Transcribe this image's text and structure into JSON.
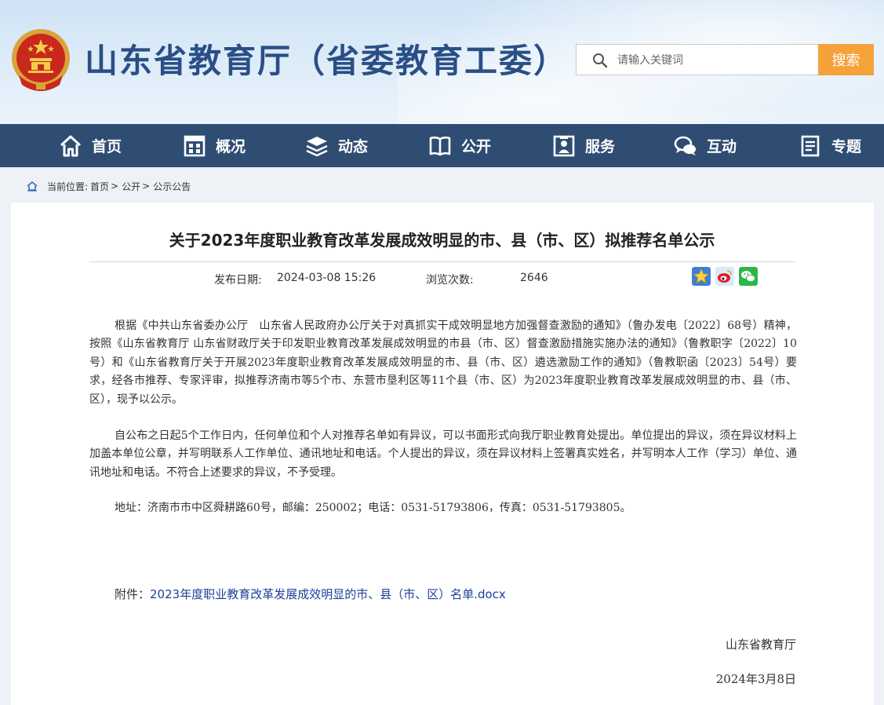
{
  "header": {
    "site_title": "山东省教育厅（省委教育工委）",
    "search": {
      "placeholder": "请输入关键词",
      "button_label": "搜索"
    }
  },
  "nav": {
    "items": [
      {
        "label": "首页",
        "icon": "home-icon"
      },
      {
        "label": "概况",
        "icon": "building-icon"
      },
      {
        "label": "动态",
        "icon": "layers-icon"
      },
      {
        "label": "公开",
        "icon": "open-book-icon"
      },
      {
        "label": "服务",
        "icon": "service-icon"
      },
      {
        "label": "互动",
        "icon": "chat-icon"
      },
      {
        "label": "专题",
        "icon": "document-icon"
      }
    ]
  },
  "breadcrumb": {
    "prefix": "当前位置:",
    "items": [
      "首页",
      "公开",
      "公示公告"
    ],
    "separator": ">"
  },
  "article": {
    "title": "关于2023年度职业教育改革发展成效明显的市、县（市、区）拟推荐名单公示",
    "publish_label": "发布日期:",
    "publish_date": "2024-03-08 15:26",
    "views_label": "浏览次数:",
    "views": "2646",
    "share_icons": [
      "star-favorite-icon",
      "weibo-icon",
      "wechat-icon"
    ],
    "paragraphs": [
      "根据《中共山东省委办公厅　山东省人民政府办公厅关于对真抓实干成效明显地方加强督查激励的通知》（鲁办发电〔2022〕68号）精神，按照《山东省教育厅 山东省财政厅关于印发职业教育改革发展成效明显的市县（市、区）督查激励措施实施办法的通知》（鲁教职字〔2022〕10号）和《山东省教育厅关于开展2023年度职业教育改革发展成效明显的市、县（市、区）遴选激励工作的通知》（鲁教职函〔2023〕54号）要求，经各市推荐、专家评审，拟推荐济南市等5个市、东营市垦利区等11个县（市、区）为2023年度职业教育改革发展成效明显的市、县（市、区），现予以公示。",
      "自公布之日起5个工作日内，任何单位和个人对推荐名单如有异议，可以书面形式向我厅职业教育处提出。单位提出的异议，须在异议材料上加盖本单位公章，并写明联系人工作单位、通讯地址和电话。个人提出的异议，须在异议材料上签署真实姓名，并写明本人工作（学习）单位、通讯地址和电话。不符合上述要求的异议，不予受理。",
      "地址：济南市市中区舜耕路60号，邮编：250002；电话：0531-51793806，传真：0531-51793805。"
    ],
    "attachment_label": "附件：",
    "attachment_link": "2023年度职业教育改革发展成效明显的市、县（市、区）名单.docx",
    "signature_org": "山东省教育厅",
    "signature_date": "2024年3月8日"
  },
  "colors": {
    "nav_bg": "#2f4d72",
    "title_blue": "#2a4f86",
    "search_button": "#f5a23a",
    "link": "#1f3f9a"
  }
}
